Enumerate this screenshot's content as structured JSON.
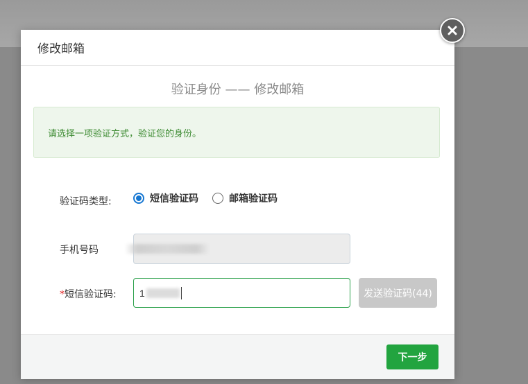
{
  "dialog": {
    "title": "修改邮箱",
    "step_title": "验证身份 —— 修改邮箱",
    "alert_text": "请选择一项验证方式，验证您的身份。",
    "close_icon": "close-icon"
  },
  "form": {
    "type_label": "验证码类型:",
    "options": [
      {
        "label": "短信验证码",
        "checked": true
      },
      {
        "label": "邮箱验证码",
        "checked": false
      }
    ],
    "phone_label": "手机号码",
    "phone_value": "",
    "code_required_mark": "*",
    "code_label": "短信验证码:",
    "code_value": "1",
    "send_button": "发送验证码(44)"
  },
  "footer": {
    "next_button": "下一步"
  },
  "colors": {
    "accent": "#22a43f",
    "radio": "#1677d2",
    "alert_text": "#3d8b32"
  }
}
